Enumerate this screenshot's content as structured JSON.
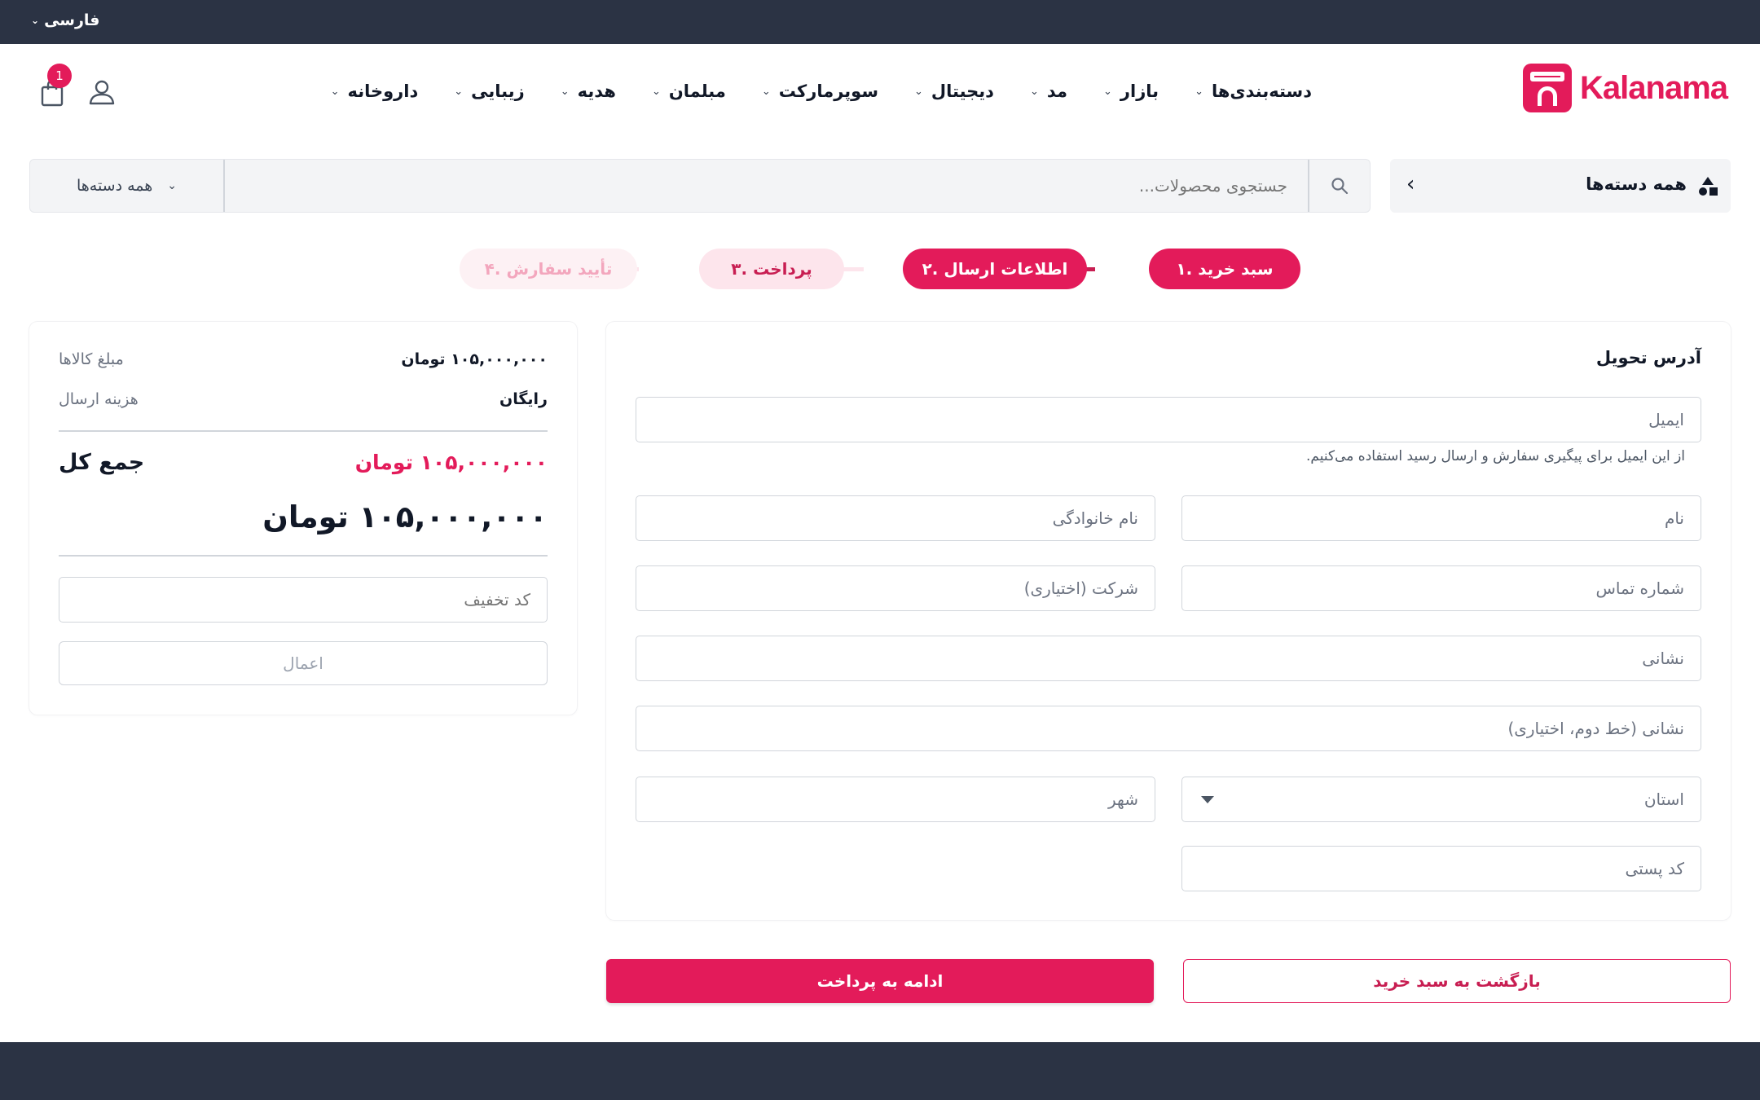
{
  "topbar": {
    "language": "فارسی"
  },
  "header": {
    "logo_text": "Kalanama",
    "cart_count": "1",
    "nav": [
      {
        "label": "دسته‌بندی‌ها"
      },
      {
        "label": "بازار"
      },
      {
        "label": "مد"
      },
      {
        "label": "دیجیتال"
      },
      {
        "label": "سوپرمارکت"
      },
      {
        "label": "مبلمان"
      },
      {
        "label": "هدیه"
      },
      {
        "label": "زیبایی"
      },
      {
        "label": "داروخانه"
      }
    ]
  },
  "search": {
    "all_categories_label": "همه دسته‌ها",
    "category_select": "همه دسته‌ها",
    "placeholder": "جستجوی محصولات..."
  },
  "steps": [
    {
      "label": "۱. سبد خرید",
      "state": "completed"
    },
    {
      "label": "۲. اطلاعات ارسال",
      "state": "active"
    },
    {
      "label": "۳. پرداخت",
      "state": "pending"
    },
    {
      "label": "۴. تأیید سفارش",
      "state": "future"
    }
  ],
  "form": {
    "title": "آدرس تحویل",
    "email_placeholder": "ایمیل",
    "email_hint": "از این ایمیل برای پیگیری سفارش و ارسال رسید استفاده می‌کنیم.",
    "first_name_placeholder": "نام",
    "last_name_placeholder": "نام خانوادگی",
    "phone_placeholder": "شماره تماس",
    "company_placeholder": "شرکت (اختیاری)",
    "address_placeholder": "نشانی",
    "address2_placeholder": "نشانی (خط دوم، اختیاری)",
    "province_placeholder": "استان",
    "city_placeholder": "شهر",
    "postal_placeholder": "کد پستی"
  },
  "summary": {
    "items_label": "مبلغ کالاها",
    "items_value": "۱۰۵,۰۰۰,۰۰۰ تومان",
    "shipping_label": "هزینه ارسال",
    "shipping_value": "رایگان",
    "total_label": "جمع کل",
    "total_value": "۱۰۵,۰۰۰,۰۰۰ تومان",
    "big_total": "۱۰۵,۰۰۰,۰۰۰ تومان",
    "coupon_placeholder": "کد تخفیف",
    "apply_label": "اعمال"
  },
  "actions": {
    "continue_label": "ادامه به پرداخت",
    "back_label": "بازگشت به سبد خرید"
  },
  "colors": {
    "brand": "#e31b5a",
    "dark_bar": "#2b3344",
    "panel_bg": "#f3f4f6"
  }
}
